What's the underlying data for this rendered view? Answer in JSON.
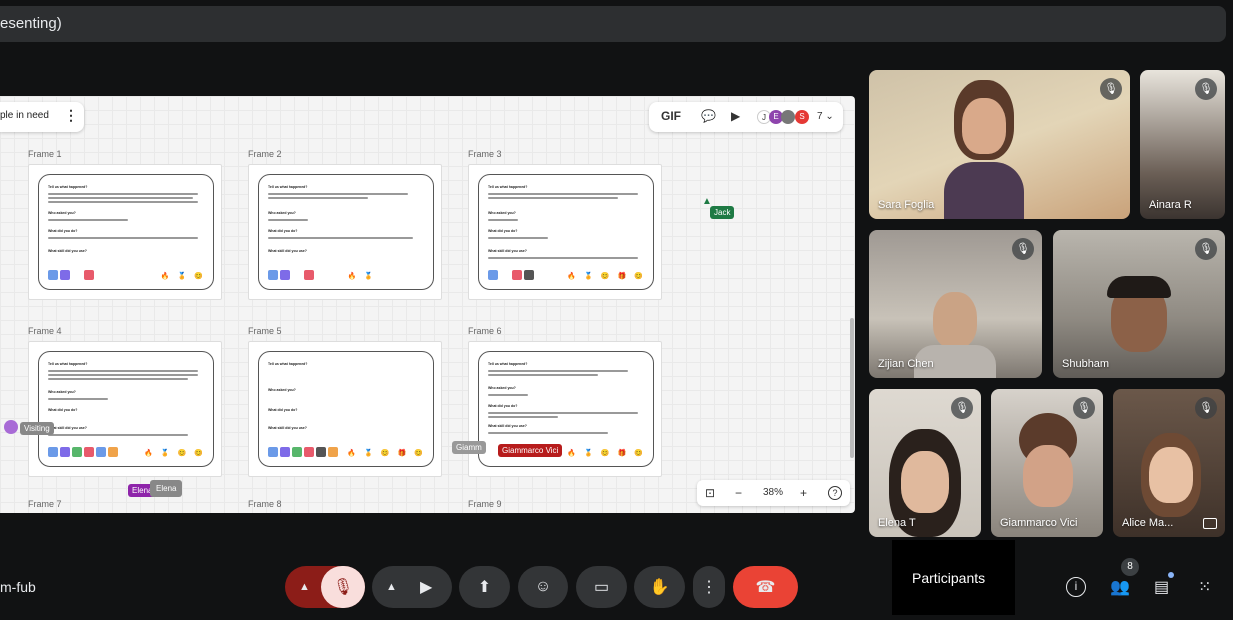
{
  "topbar": {
    "title": "esenting)"
  },
  "board": {
    "title": "ple in need",
    "more": "⋮",
    "tools": {
      "gif": "GIF",
      "chat": "💬",
      "video": "▶",
      "count": "7 ⌄"
    },
    "collaborators": [
      "J",
      "E",
      "S"
    ],
    "frames": [
      {
        "label": "Frame 1",
        "questions": [
          "Tell us what happened?",
          "Who asked you?",
          "What did you do?",
          "What skill did you use?"
        ]
      },
      {
        "label": "Frame 2",
        "questions": [
          "Tell us what happened?",
          "Who asked you?",
          "What did you do?",
          "What skill did you use?"
        ]
      },
      {
        "label": "Frame 3",
        "questions": [
          "Tell us what happened?",
          "Who asked you?",
          "What did you do?",
          "What skill did you use?"
        ]
      },
      {
        "label": "Frame 4",
        "questions": [
          "Tell us what happened?",
          "Who asked you?",
          "What did you do?",
          "What skill did you use?"
        ]
      },
      {
        "label": "Frame 5",
        "questions": [
          "Tell us what happened?",
          "Who asked you?",
          "What did you do?",
          "What skill did you use?"
        ]
      },
      {
        "label": "Frame 6",
        "questions": [
          "Tell us what happened?",
          "Who asked you?",
          "What did you do?",
          "What skill did you use?"
        ]
      }
    ],
    "more_frames": [
      "Frame 7",
      "Frame 8",
      "Frame 9"
    ],
    "cursors": {
      "jack": "Jack",
      "visiting": "Visiting",
      "elena_purple": "Elena",
      "elena_gray": "Elena",
      "giammarco": "Giammarco Vici",
      "giamm_partial": "Giamm"
    },
    "zoom": {
      "fit": "⊡",
      "minus": "−",
      "level": "38%",
      "plus": "+",
      "help": "?"
    }
  },
  "participants": [
    {
      "name": "Sara Foglia"
    },
    {
      "name": "Ainara R"
    },
    {
      "name": "Zijian Chen"
    },
    {
      "name": "Shubham"
    },
    {
      "name": "Elena T"
    },
    {
      "name": "Giammarco Vici"
    },
    {
      "name": "Alice Ma..."
    }
  ],
  "bottom": {
    "meeting_code": "m-fub",
    "participants_tooltip": "Participants",
    "people_count": "8",
    "colors": {
      "end_call": "#ea4335",
      "mic_off_bg": "#f9dedc",
      "mic_caret_bg": "#8c1d18"
    }
  }
}
